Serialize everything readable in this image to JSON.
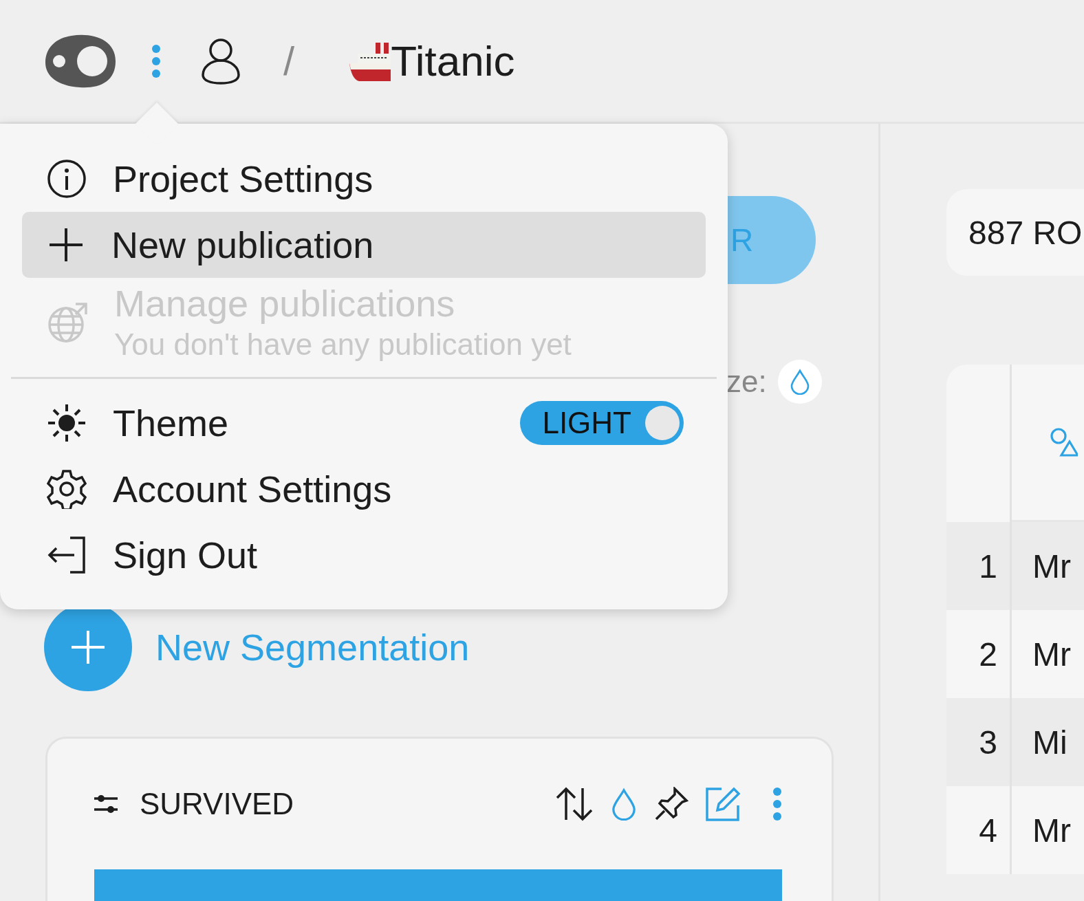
{
  "header": {
    "separator": "/",
    "project_title": "Titanic"
  },
  "menu": {
    "sections": [
      {
        "items": [
          {
            "kind": "action",
            "label": "Project Settings",
            "selected": false,
            "disabled": false
          },
          {
            "kind": "action",
            "label": "New publication",
            "selected": true,
            "disabled": false
          },
          {
            "kind": "action",
            "label": "Manage publications",
            "subtitle": "You don't have any publication yet",
            "selected": false,
            "disabled": true
          }
        ]
      },
      {
        "items": [
          {
            "kind": "toggle",
            "label": "Theme",
            "selected": false,
            "disabled": false,
            "toggle": {
              "label": "LIGHT",
              "on": true
            }
          },
          {
            "kind": "action",
            "label": "Account Settings",
            "selected": false,
            "disabled": false
          },
          {
            "kind": "action",
            "label": "Sign Out",
            "selected": false,
            "disabled": false
          }
        ]
      }
    ]
  },
  "left_panel": {
    "publish_button": "R",
    "colorize_label": "ze:",
    "new_segmentation": "New Segmentation",
    "segment_card": {
      "title": "SURVIVED"
    }
  },
  "right_panel": {
    "row_count": "887 RO",
    "table": {
      "rows": [
        {
          "index": "1",
          "name": "Mr"
        },
        {
          "index": "2",
          "name": "Mr"
        },
        {
          "index": "3",
          "name": "Mi"
        },
        {
          "index": "4",
          "name": "Mr"
        }
      ]
    }
  }
}
